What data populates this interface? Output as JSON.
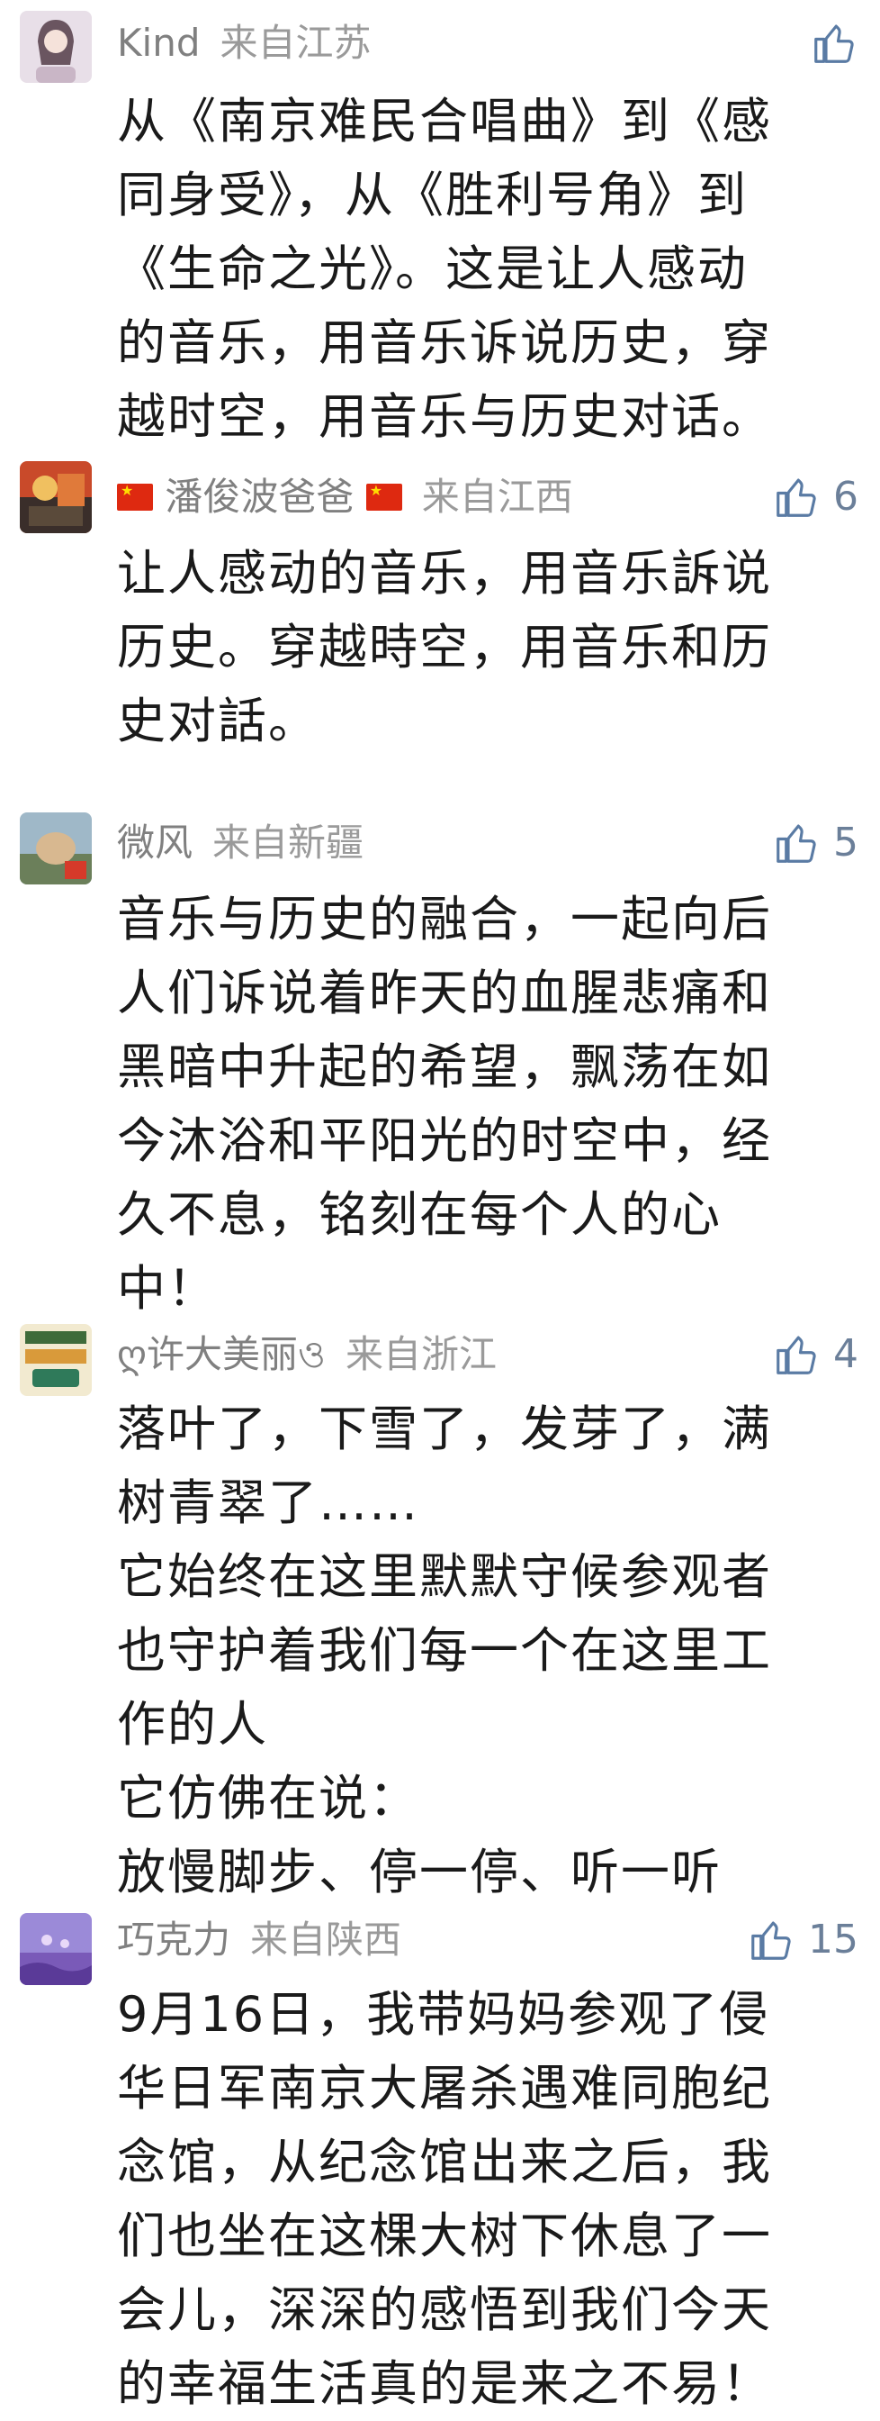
{
  "comments": [
    {
      "username": "Kind",
      "location": "来自江苏",
      "likes": "",
      "lines": [
        "从《南京难民合唱曲》到《感",
        "同身受》，从《胜利号角》到",
        "《生命之光》。这是让人感动",
        "的音乐，用音乐诉说历史，穿",
        "越时空，用音乐与历史对话。"
      ]
    },
    {
      "username": "潘俊波爸爸",
      "location": "来自江西",
      "likes": "6",
      "lines": [
        "让人感动的音乐，用音乐訴说",
        "历史。穿越時空，用音乐和历",
        "史对話。"
      ]
    },
    {
      "username": "微风",
      "location": "来自新疆",
      "likes": "5",
      "lines": [
        "音乐与历史的融合，一起向后",
        "人们诉说着昨天的血腥悲痛和",
        "黑暗中升起的希望，飘荡在如",
        "今沐浴和平阳光的时空中，经",
        "久不息，铭刻在每个人的心",
        "中！"
      ]
    },
    {
      "username": "ღ许大美丽ও",
      "location": "来自浙江",
      "likes": "4",
      "lines": [
        "落叶了，下雪了，发芽了，满",
        "树青翠了……",
        "它始终在这里默默守候参观者",
        "也守护着我们每一个在这里工",
        "作的人",
        "它仿佛在说：",
        "放慢脚步、停一停、听一听"
      ]
    },
    {
      "username": "巧克力",
      "location": "来自陕西",
      "likes": "15",
      "lines": [
        "9月16日，我带妈妈参观了侵",
        "华日军南京大屠杀遇难同胞纪",
        "念馆，从纪念馆出来之后，我",
        "们也坐在这棵大树下休息了一",
        "会儿，深深的感悟到我们今天",
        "的幸福生活真的是来之不易！"
      ]
    }
  ],
  "colors": {
    "username": "#808080",
    "like_icon": "#5a7ba4",
    "text": "#1a1a1a",
    "background": "#ffffff"
  },
  "icons": {
    "like": "thumbs-up-icon",
    "flag": "china-flag-icon"
  }
}
